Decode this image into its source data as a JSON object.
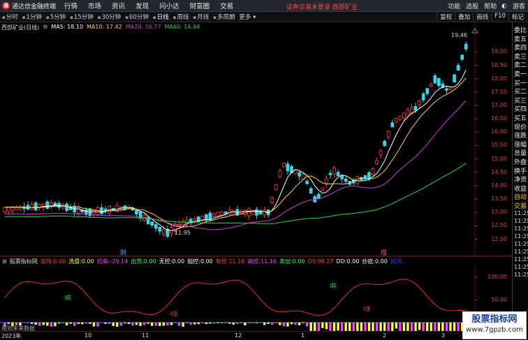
{
  "menubar": {
    "app_logo": "通",
    "app_title": "通达信金融终端",
    "items": [
      "行情",
      "市场",
      "资讯",
      "发现",
      "问小达",
      "财富圈",
      "交易"
    ],
    "notice": "证券交易未登录 西部矿业",
    "right_items": [
      "功能",
      "选股",
      "帮助",
      "游客"
    ]
  },
  "toolbar": {
    "tabs": [
      "分时",
      "1分钟",
      "5分钟",
      "15分钟",
      "30分钟",
      "60分钟",
      "日线",
      "周线",
      "月线",
      "多周期",
      "更多"
    ],
    "active_tab": "日线",
    "right_buttons": [
      "复权",
      "叠加",
      "画线",
      "F10",
      "标记"
    ]
  },
  "legend": {
    "title": "西部矿业(日线)",
    "ma5": "MA5: 18.10",
    "ma10": "MA10: 17.42",
    "ma20": "MA20: 16.77",
    "ma60": "MA60: 14.94"
  },
  "colors": {
    "up": "#ff3b3b",
    "down": "#35d6e8",
    "ma5": "#ffffff",
    "ma10": "#ffd24a",
    "ma20": "#d13cd1",
    "ma60": "#2fd62f",
    "grid": "#5a1414"
  },
  "chart_data": {
    "type": "candlestick",
    "title": "西部矿业(日线)",
    "ylim": [
      11.7,
      19.9
    ],
    "y_ticks": [
      "19.00",
      "18.50",
      "18.00",
      "17.50",
      "17.00",
      "16.50",
      "16.00",
      "15.50",
      "15.00",
      "14.50",
      "14.00",
      "13.50",
      "13.00",
      "12.50",
      "12.00"
    ],
    "annotations": {
      "high_label": "19.46",
      "low_label": "11.95"
    },
    "markers": {
      "cai": "财",
      "zeng": "增"
    },
    "ma_readout": {
      "MA5": 18.1,
      "MA10": 17.42,
      "MA20": 16.77,
      "MA60": 14.94
    }
  },
  "indicator": {
    "name": "股票指标网",
    "items": [
      {
        "label": "追场",
        "value": "0.00",
        "color": "#ff4040"
      },
      {
        "label": "洗盘",
        "value": "0.00",
        "color": "#ffff40"
      },
      {
        "label": "拉高",
        "value": "-29.14",
        "color": "#ff40ff"
      },
      {
        "label": "出货",
        "value": "0.00",
        "color": "#40ff40"
      },
      {
        "label": "无控",
        "value": "0.00",
        "color": "#ffffff"
      },
      {
        "label": "抛控",
        "value": "0.00",
        "color": "#ffffff"
      },
      {
        "label": "有控",
        "value": "11.16",
        "color": "#ff4040"
      },
      {
        "label": "高控",
        "value": "11.16",
        "color": "#ff40ff"
      },
      {
        "label": "卖出",
        "value": "0.00",
        "color": "#40ff40"
      },
      {
        "label": "OS",
        "value": "99.27",
        "color": "#ff4040"
      },
      {
        "label": "DD",
        "value": "0.00",
        "color": "#ffffff"
      },
      {
        "label": "抄底",
        "value": "0.00",
        "color": "#ffffff"
      },
      {
        "label": "逃顶",
        "value": "",
        "color": "#4040ff"
      }
    ],
    "y_ticks": [
      "100.00",
      "50.00",
      "0.00"
    ],
    "labels": {
      "die1": "I跌",
      "die2": "I跌",
      "zhang1": "I涨",
      "zhang2": "I涨"
    }
  },
  "footer_note": "用到未来数据",
  "date_axis": [
    "2023年",
    "10",
    "11",
    "12",
    "1",
    "2",
    "3"
  ],
  "quote_panel": {
    "labels": [
      "委比",
      "卖五",
      "卖四",
      "卖三",
      "卖二",
      "卖一",
      "买一",
      "买二",
      "买三",
      "买四",
      "买五",
      "现价",
      "涨跌",
      "涨幅",
      "总量",
      "外盘",
      "换手",
      "净资",
      "收益"
    ],
    "auto": "自动",
    "trade": "交易",
    "times": [
      "11:25",
      "11:25",
      "11:25",
      "11:25",
      "11:25",
      "11:25",
      "11:25",
      "11:25",
      "11:25"
    ]
  },
  "watermark": {
    "title": "股票指标网",
    "url": "www.7gpzb.com"
  }
}
